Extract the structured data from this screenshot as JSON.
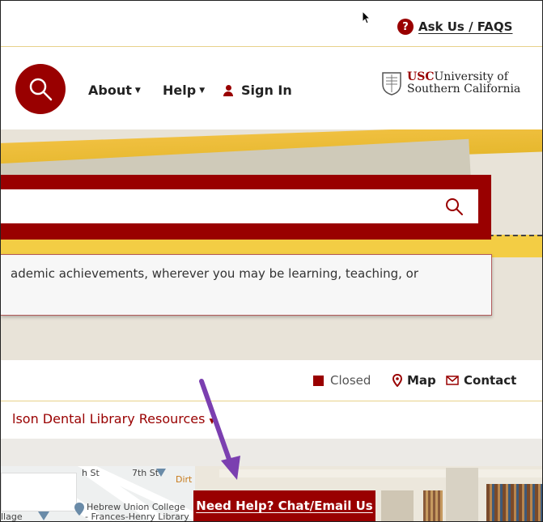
{
  "utility": {
    "ask_label": "Ask Us / FAQS",
    "ask_icon": "question-circle-icon"
  },
  "nav": {
    "items": [
      {
        "label": "About"
      },
      {
        "label": "Help"
      },
      {
        "label": "Sign In"
      }
    ],
    "logo_usc": "USC",
    "logo_line1": "University of",
    "logo_line2": "Southern California"
  },
  "hero": {
    "search_placeholder": "",
    "tagline": "ademic achievements, wherever you may be learning, teaching, or"
  },
  "status": {
    "hours_status": "Closed",
    "map_label": "Map",
    "contact_label": "Contact"
  },
  "resources": {
    "link_label": "lson Dental Library Resources"
  },
  "map": {
    "street1": "h St",
    "street2": "7th St",
    "poi": "Dirt D",
    "place1": "Hebrew Union College",
    "place2": "- Frances-Henry Library",
    "place3": "llage"
  },
  "help_button": {
    "label": "Need Help? Chat/Email Us"
  },
  "colors": {
    "brand": "#990000",
    "gold": "#f2c83c",
    "arrow": "#7b3fb0"
  }
}
